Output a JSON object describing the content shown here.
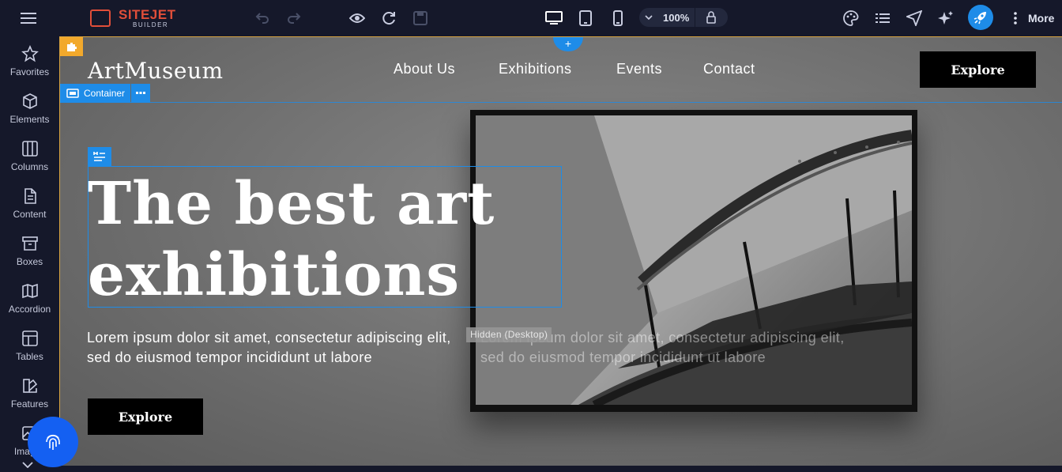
{
  "editor": {
    "brand": "SITEJET",
    "brand_sub": "BUILDER",
    "zoom": "100%",
    "more_label": "More",
    "accent": "#1e8ce8",
    "brand_color": "#e04e39"
  },
  "sidebar": {
    "items": [
      {
        "label": "Favorites",
        "icon": "star-icon"
      },
      {
        "label": "Elements",
        "icon": "cube-icon"
      },
      {
        "label": "Columns",
        "icon": "columns-icon"
      },
      {
        "label": "Content",
        "icon": "document-icon"
      },
      {
        "label": "Boxes",
        "icon": "archive-icon"
      },
      {
        "label": "Accordion",
        "icon": "map-icon"
      },
      {
        "label": "Tables",
        "icon": "table-icon"
      },
      {
        "label": "Features",
        "icon": "features-icon"
      },
      {
        "label": "Images",
        "icon": "image-icon"
      }
    ]
  },
  "site": {
    "logo": "ArtMuseum",
    "nav": [
      "About Us",
      "Exhibitions",
      "Events",
      "Contact"
    ],
    "header_button": "Explore",
    "container_label": "Container",
    "heading": "The best art exhibitions",
    "paragraph": "Lorem ipsum dolor sit amet, consectetur adipiscing elit, sed do eiusmod tempor incididunt ut labore",
    "paragraph_hidden": "Lorem ipsum dolor sit amet, consectetur adipiscing elit, sed do eiusmod tempor incididunt ut labore",
    "hidden_badge": "Hidden (Desktop)",
    "hero_button": "Explore"
  }
}
